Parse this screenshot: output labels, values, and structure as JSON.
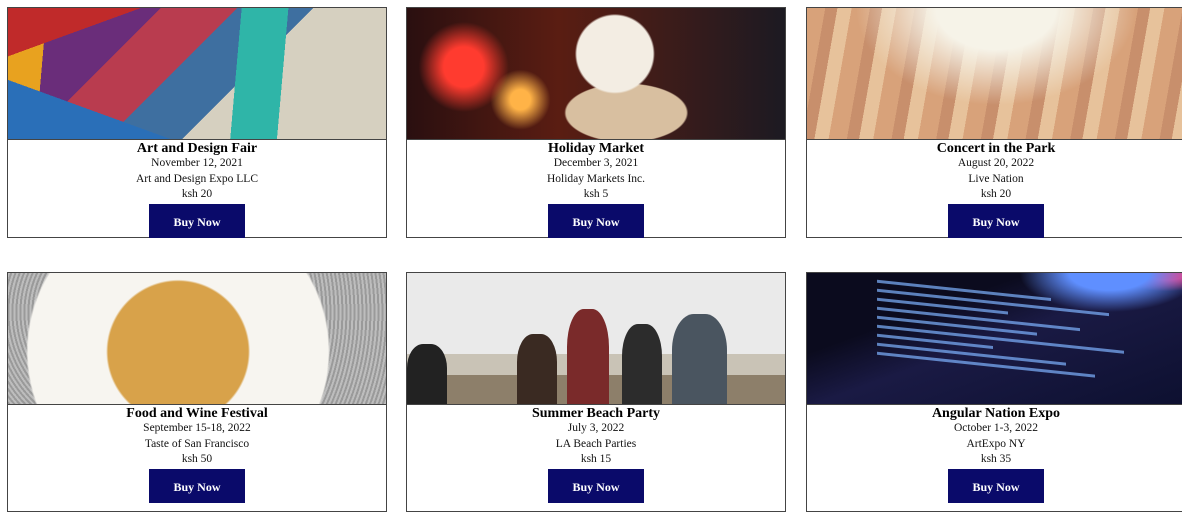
{
  "events": [
    {
      "title": "Art and Design Fair",
      "date": "November 12, 2021",
      "organizer": "Art and Design Expo LLC",
      "price": "ksh 20",
      "button": "Buy Now"
    },
    {
      "title": "Holiday Market",
      "date": "December 3, 2021",
      "organizer": "Holiday Markets Inc.",
      "price": "ksh 5",
      "button": "Buy Now"
    },
    {
      "title": "Concert in the Park",
      "date": "August 20, 2022",
      "organizer": "Live Nation",
      "price": "ksh 20",
      "button": "Buy Now"
    },
    {
      "title": "Food and Wine Festival",
      "date": "September 15-18, 2022",
      "organizer": "Taste of San Francisco",
      "price": "ksh 50",
      "button": "Buy Now"
    },
    {
      "title": "Summer Beach Party",
      "date": "July 3, 2022",
      "organizer": "LA Beach Parties",
      "price": "ksh 15",
      "button": "Buy Now"
    },
    {
      "title": "Angular Nation Expo",
      "date": "October 1-3, 2022",
      "organizer": "ArtExpo NY",
      "price": "ksh 35",
      "button": "Buy Now"
    }
  ],
  "colors": {
    "button_bg": "#0a0a6a",
    "button_text": "#ffffff",
    "card_border": "#444444"
  }
}
